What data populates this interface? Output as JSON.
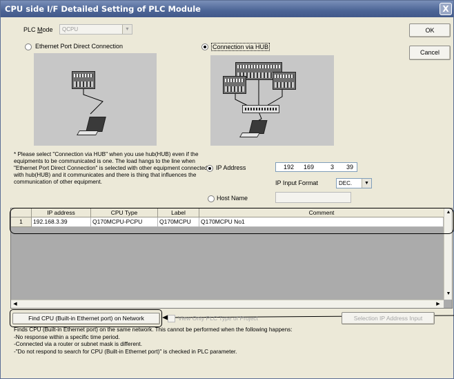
{
  "window": {
    "title": "CPU side I/F Detailed Setting of PLC Module",
    "close_label": "X"
  },
  "plc_mode": {
    "label_prefix": "PLC ",
    "label_underlined": "M",
    "label_suffix": "ode",
    "value": "QCPU"
  },
  "buttons": {
    "ok": "OK",
    "cancel": "Cancel",
    "find_cpu": "Find CPU (Built-in Ethernet port) on Network",
    "selection_ip": "Selection IP Address Input"
  },
  "connection": {
    "direct_label": "Ethernet Port Direct Connection",
    "hub_label": "Connection via HUB",
    "selected": "hub"
  },
  "note": "* Please select \"Connection via HUB\" when you use hub(HUB) even if the equipments to be communicated is one. The load hangs to the line when \"Ethernet Port Direct Connection\" is selected with other equipment connected with hub(HUB) and it communicates and there is thing that influences the communication of other equipment.",
  "address": {
    "ip_radio_label": "IP Address",
    "ip_octets": [
      "192",
      "169",
      "3",
      "39"
    ],
    "input_format_label": "IP Input Format",
    "input_format_value": "DEC.",
    "host_radio_label": "Host Name",
    "host_value": "",
    "selected": "ip"
  },
  "grid": {
    "columns": [
      "IP address",
      "CPU Type",
      "Label",
      "Comment"
    ],
    "rows": [
      {
        "num": "1",
        "ip": "192.168.3.39",
        "cpu_type": "Q170MCPU-PCPU",
        "label": "Q170MCPU",
        "comment": "Q170MCPU No1"
      }
    ]
  },
  "view_only_label": "View Only PLC Type of Project",
  "description": [
    "Finds CPU (Built-in Ethernet port) on the same network. This cannot be performed when the following happens:",
    "-No response within a specific time period.",
    "-Connected via a router or subnet mask is different.",
    "-\"Do not respond to search for CPU (Built-in Ethernet port)\" is checked in PLC parameter."
  ],
  "icons": [
    "close-icon",
    "combo-arrow-icon",
    "scroll-up-icon",
    "scroll-down-icon",
    "scroll-left-icon",
    "scroll-right-icon"
  ]
}
